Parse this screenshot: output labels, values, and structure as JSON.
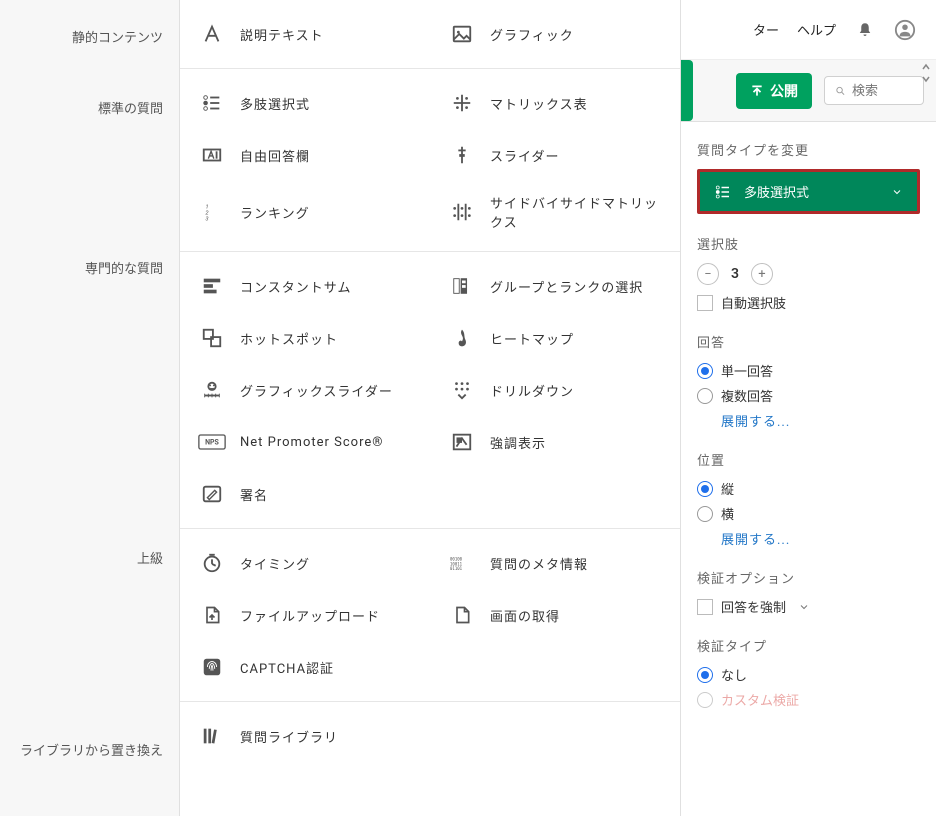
{
  "top": {
    "link_partial": "ター",
    "help": "ヘルプ"
  },
  "publish_label": "公開",
  "search_placeholder": "検索",
  "categories": {
    "static": "静的コンテンツ",
    "standard": "標準の質問",
    "specialized": "専門的な質問",
    "advanced": "上級",
    "library": "ライブラリから置き換え"
  },
  "types": {
    "desc_text": "説明テキスト",
    "graphic": "グラフィック",
    "multiple_choice": "多肢選択式",
    "matrix": "マトリックス表",
    "text_entry": "自由回答欄",
    "slider": "スライダー",
    "ranking": "ランキング",
    "side_by_side": "サイドバイサイドマトリックス",
    "constant_sum": "コンスタントサム",
    "group_rank": "グループとランクの選択",
    "hotspot": "ホットスポット",
    "heatmap": "ヒートマップ",
    "graphic_slider": "グラフィックスライダー",
    "drilldown": "ドリルダウン",
    "nps": "Net Promoter Score®",
    "highlight": "強調表示",
    "signature": "署名",
    "timing": "タイミング",
    "meta": "質問のメタ情報",
    "file_upload": "ファイルアップロード",
    "screen_capture": "画面の取得",
    "captcha": "CAPTCHA認証",
    "question_library": "質問ライブラリ"
  },
  "sidebar": {
    "change_qtype": "質問タイプを変更",
    "qtype_selected": "多肢選択式",
    "choices": "選択肢",
    "choices_count": "3",
    "auto_choices": "自動選択肢",
    "answers": "回答",
    "single": "単一回答",
    "multi": "複数回答",
    "expand": "展開する...",
    "position": "位置",
    "vertical": "縦",
    "horizontal": "横",
    "validation_options": "検証オプション",
    "force_response": "回答を強制",
    "validation_type": "検証タイプ",
    "none": "なし",
    "custom_partial": "カスタム検証"
  }
}
